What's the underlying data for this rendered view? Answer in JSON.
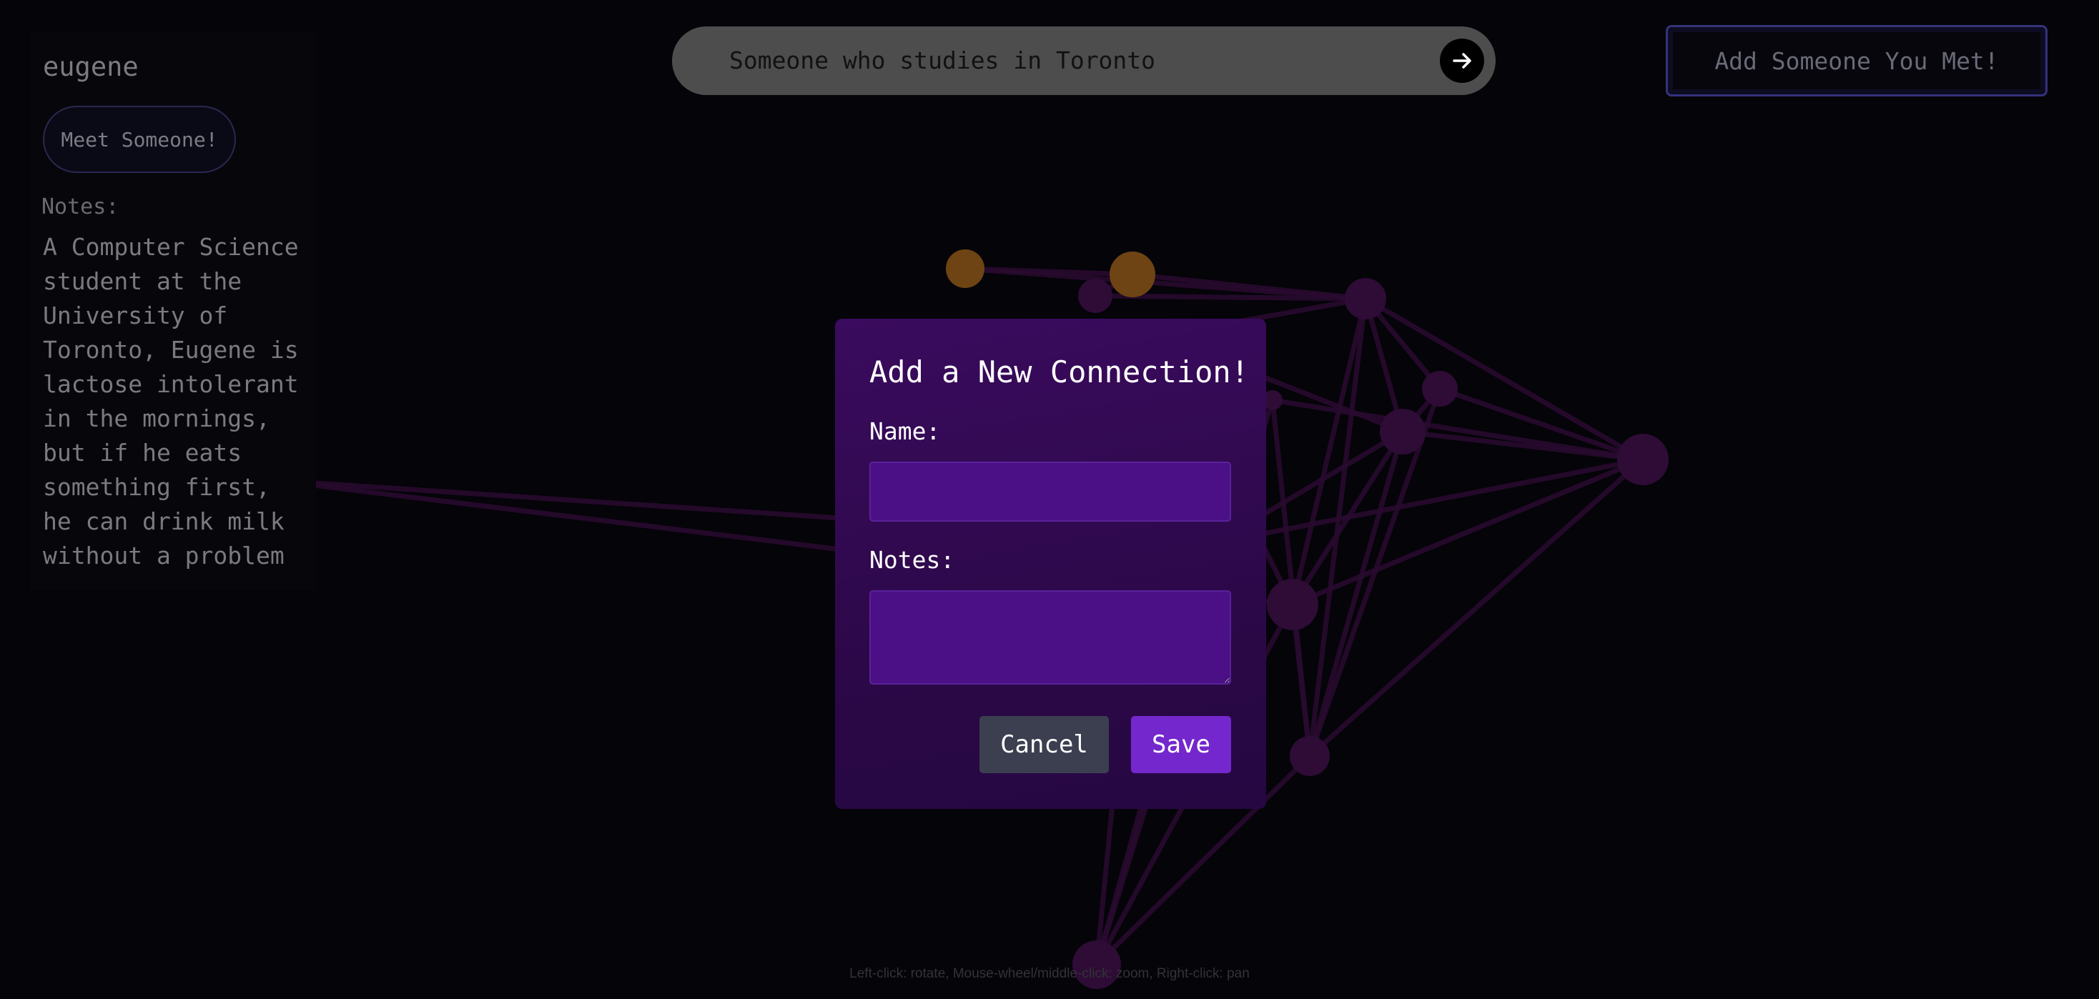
{
  "person": {
    "name": "eugene",
    "meet_label": "Meet Someone!",
    "notes_label": "Notes:",
    "notes": "A Computer Science student at the University of Toronto, Eugene is lactose intolerant in the mornings, but if he eats something first, he can drink milk without a problem"
  },
  "search": {
    "query": "Someone who studies in Toronto",
    "submit_icon": "arrow-right-icon"
  },
  "header": {
    "add_label": "Add Someone You Met!"
  },
  "help_text": "Left-click: rotate, Mouse-wheel/middle-click: zoom, Right-click: pan",
  "modal": {
    "title": "Add a New Connection!",
    "name_label": "Name:",
    "name_value": "",
    "notes_label": "Notes:",
    "notes_value": "",
    "cancel_label": "Cancel",
    "save_label": "Save"
  },
  "colors": {
    "background": "#050409",
    "modal_bg": "#330a54",
    "input_bg": "#4b0f86",
    "save_accent": "#7427cc",
    "cancel_bg": "#3c3f50",
    "node_highlight": "#6e4414",
    "node_default": "#2e0c36"
  }
}
